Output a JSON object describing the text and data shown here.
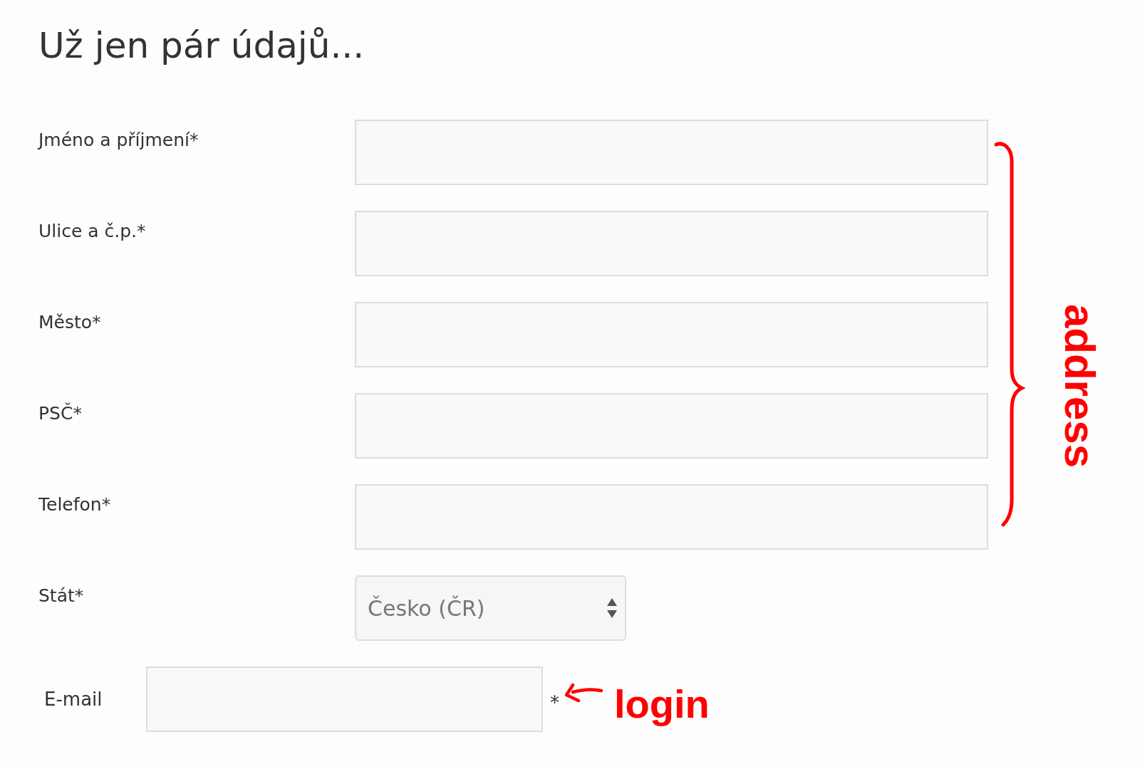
{
  "title": "Už jen pár údajů...",
  "fields": [
    {
      "label": "Jméno a příjmení*",
      "kind": "text"
    },
    {
      "label": "Ulice a č.p.*",
      "kind": "text"
    },
    {
      "label": "Město*",
      "kind": "text"
    },
    {
      "label": "PSČ*",
      "kind": "text"
    },
    {
      "label": "Telefon*",
      "kind": "text"
    },
    {
      "label": "Stát*",
      "kind": "select",
      "value": "Česko (ČR)"
    }
  ],
  "email": {
    "label": "E-mail",
    "required_mark": "*"
  },
  "annotations": [
    {
      "kind": "brace",
      "text": "address"
    },
    {
      "kind": "arrow",
      "text": "login"
    }
  ]
}
